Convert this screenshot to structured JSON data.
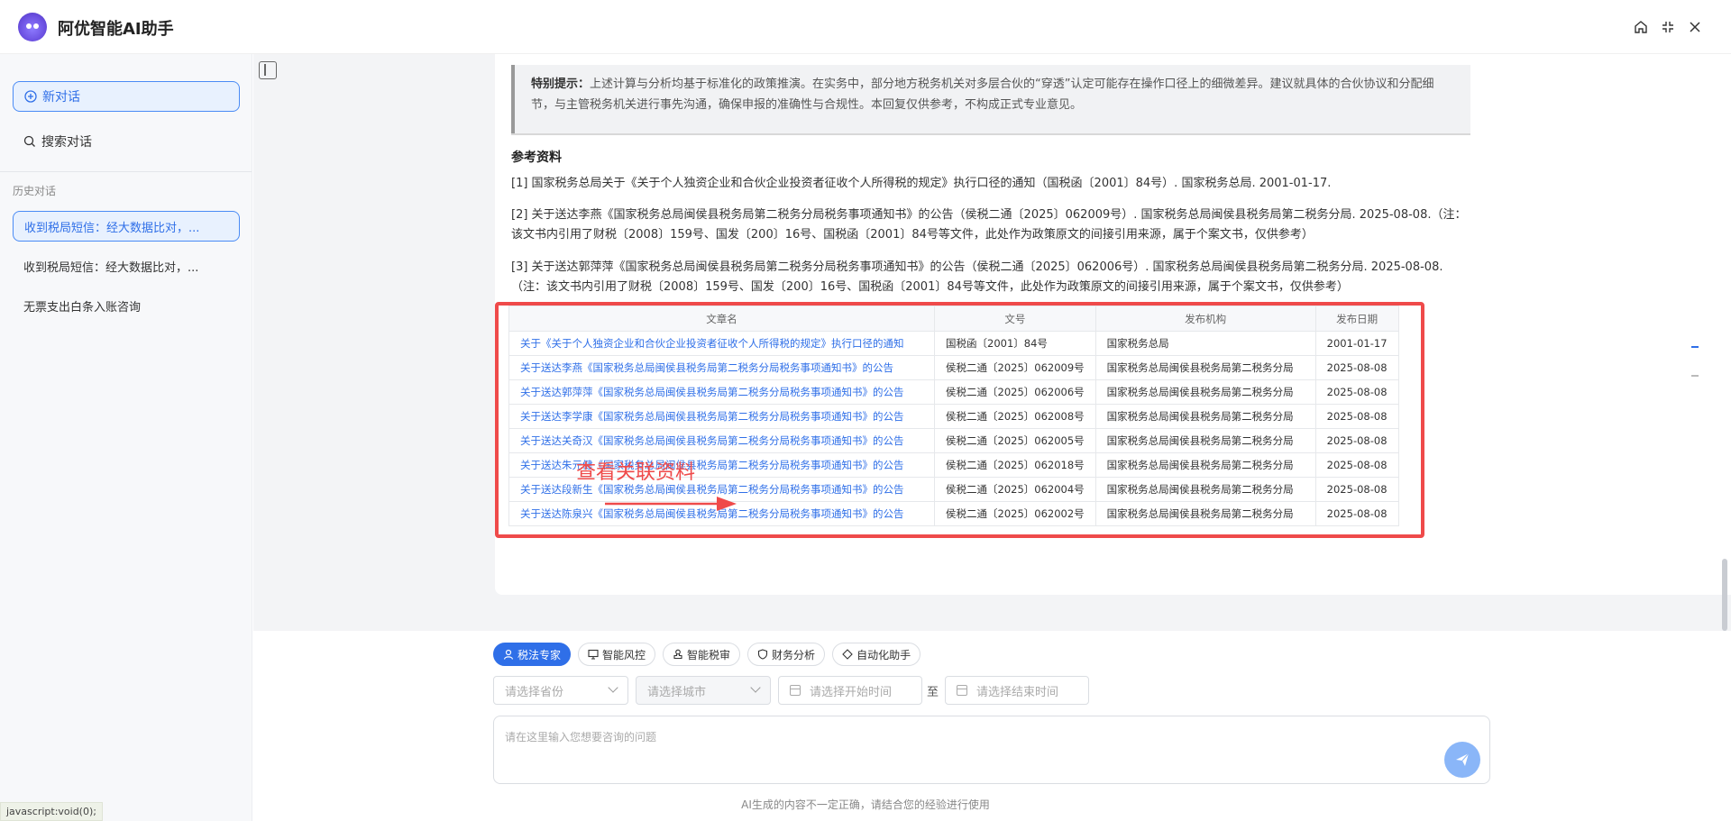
{
  "app": {
    "title": "阿优智能AI助手"
  },
  "sidebar": {
    "new_chat": "新对话",
    "search_chat": "搜索对话",
    "history_title": "历史对话",
    "items": [
      {
        "label": "收到税局短信：经大数据比对，..."
      },
      {
        "label": "收到税局短信：经大数据比对，..."
      },
      {
        "label": "无票支出白条入账咨询"
      }
    ]
  },
  "status_bar": {
    "text": "javascript:void(0);"
  },
  "content": {
    "tip_label": "特别提示：",
    "tip_text": "上述计算与分析均基于标准化的政策推演。在实务中，部分地方税务机关对多层合伙的“穿透”认定可能存在操作口径上的细微差异。建议就具体的合伙协议和分配细节，与主管税务机关进行事先沟通，确保申报的准确性与合规性。本回复仅供参考，不构成正式专业意见。",
    "refs_title": "参考资料",
    "refs": [
      "[1] 国家税务总局关于《关于个人独资企业和合伙企业投资者征收个人所得税的规定》执行口径的通知（国税函〔2001〕84号）. 国家税务总局. 2001-01-17.",
      "[2] 关于送达李燕《国家税务总局闽侯县税务局第二税务分局税务事项通知书》的公告（侯税二通〔2025〕062009号）. 国家税务总局闽侯县税务局第二税务分局. 2025-08-08.（注：该文书内引用了财税〔2008〕159号、国发〔200〕16号、国税函〔2001〕84号等文件，此处作为政策原文的间接引用来源，属于个案文书，仅供参考）",
      "[3] 关于送达郭萍萍《国家税务总局闽侯县税务局第二税务分局税务事项通知书》的公告（侯税二通〔2025〕062006号）. 国家税务总局闽侯县税务局第二税务分局. 2025-08-08.（注：该文书内引用了财税〔2008〕159号、国发〔200〕16号、国税函〔2001〕84号等文件，此处作为政策原文的间接引用来源，属于个案文书，仅供参考）"
    ],
    "table": {
      "headers": [
        "文章名",
        "文号",
        "发布机构",
        "发布日期"
      ],
      "rows": [
        [
          "关于《关于个人独资企业和合伙企业投资者征收个人所得税的规定》执行口径的通知",
          "国税函〔2001〕84号",
          "国家税务总局",
          "2001-01-17"
        ],
        [
          "关于送达李燕《国家税务总局闽侯县税务局第二税务分局税务事项通知书》的公告",
          "侯税二通〔2025〕062009号",
          "国家税务总局闽侯县税务局第二税务分局",
          "2025-08-08"
        ],
        [
          "关于送达郭萍萍《国家税务总局闽侯县税务局第二税务分局税务事项通知书》的公告",
          "侯税二通〔2025〕062006号",
          "国家税务总局闽侯县税务局第二税务分局",
          "2025-08-08"
        ],
        [
          "关于送达李学康《国家税务总局闽侯县税务局第二税务分局税务事项通知书》的公告",
          "侯税二通〔2025〕062008号",
          "国家税务总局闽侯县税务局第二税务分局",
          "2025-08-08"
        ],
        [
          "关于送达关奇汉《国家税务总局闽侯县税务局第二税务分局税务事项通知书》的公告",
          "侯税二通〔2025〕062005号",
          "国家税务总局闽侯县税务局第二税务分局",
          "2025-08-08"
        ],
        [
          "关于送达朱元健《国家税务总局闽侯县税务局第二税务分局税务事项通知书》的公告",
          "侯税二通〔2025〕062018号",
          "国家税务总局闽侯县税务局第二税务分局",
          "2025-08-08"
        ],
        [
          "关于送达段新生《国家税务总局闽侯县税务局第二税务分局税务事项通知书》的公告",
          "侯税二通〔2025〕062004号",
          "国家税务总局闽侯县税务局第二税务分局",
          "2025-08-08"
        ],
        [
          "关于送达陈泉兴《国家税务总局闽侯县税务局第二税务分局税务事项通知书》的公告",
          "侯税二通〔2025〕062002号",
          "国家税务总局闽侯县税务局第二税务分局",
          "2025-08-08"
        ]
      ]
    },
    "annotation": "查看关联资料"
  },
  "composer": {
    "modes": [
      {
        "label": "税法专家",
        "icon": "user-icon",
        "active": true
      },
      {
        "label": "智能风控",
        "icon": "monitor-icon",
        "active": false
      },
      {
        "label": "智能税审",
        "icon": "stamp-icon",
        "active": false
      },
      {
        "label": "财务分析",
        "icon": "shield-icon",
        "active": false
      },
      {
        "label": "自动化助手",
        "icon": "diamond-icon",
        "active": false
      }
    ],
    "province_placeholder": "请选择省份",
    "city_placeholder": "请选择城市",
    "start_placeholder": "请选择开始时间",
    "to_label": "至",
    "end_placeholder": "请选择结束时间",
    "input_placeholder": "请在这里输入您想要咨询的问题",
    "disclaimer": "AI生成的内容不一定正确，请结合您的经验进行使用"
  },
  "colors": {
    "accent": "#2f6fe8",
    "highlight": "#ef4a4a"
  }
}
